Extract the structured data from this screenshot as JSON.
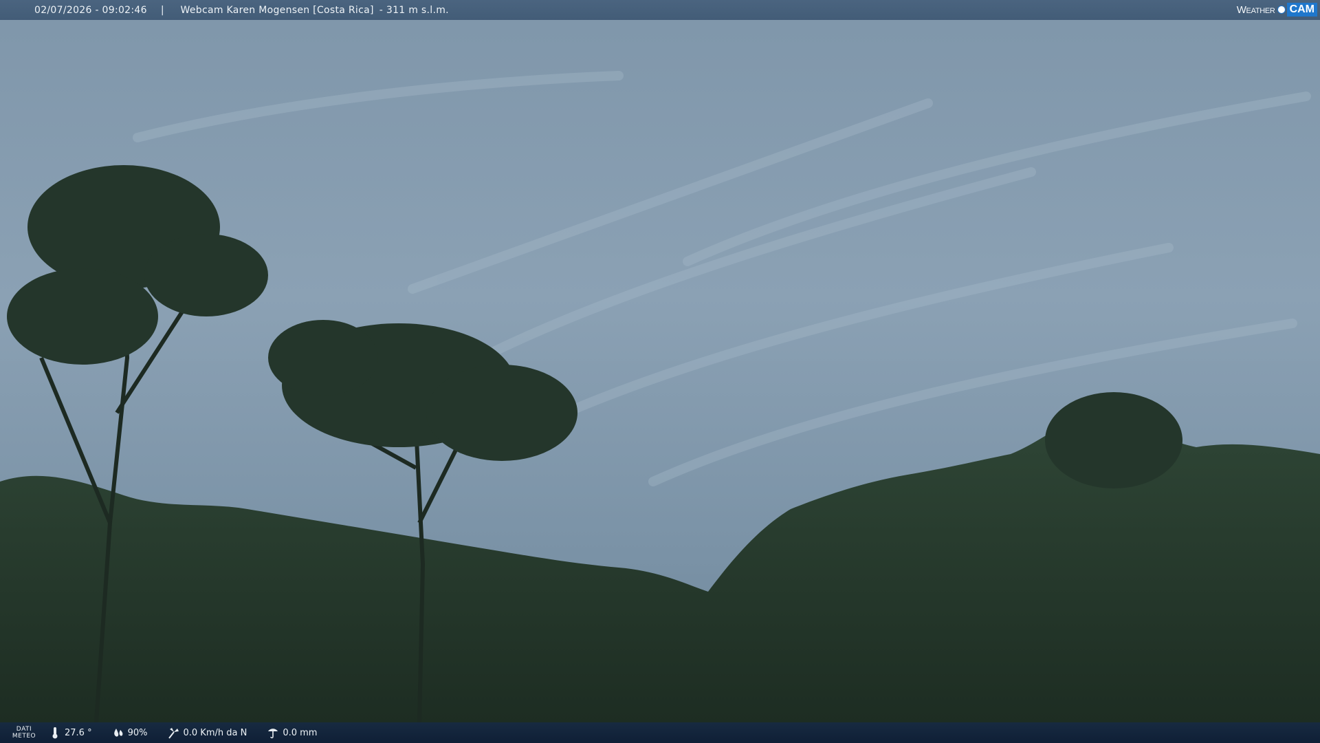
{
  "top_bar": {
    "datetime": "02/07/2026 - 09:02:46",
    "separator": "|",
    "title": "Webcam Karen Mogensen [Costa Rica]",
    "altitude": "- 311 m s.l.m."
  },
  "logo": {
    "word1": "Weather",
    "word2": "CAM",
    "accent_color": "#1f77cc"
  },
  "bottom_bar": {
    "label_line1": "DATI",
    "label_line2": "METEO",
    "temperature": "27.6 °",
    "humidity": "90%",
    "wind": "0.0 Km/h da N",
    "rain": "0.0 mm",
    "icons": [
      "thermometer-icon",
      "humidity-drop-icon",
      "wind-icon",
      "rain-gauge-icon"
    ]
  }
}
